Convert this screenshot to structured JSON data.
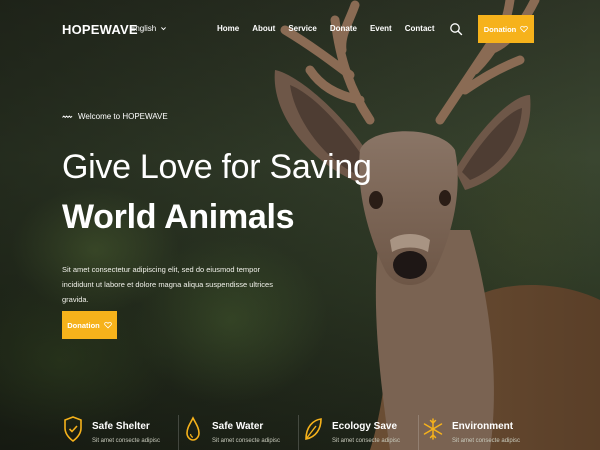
{
  "brand": {
    "name": "HOPEWAVE",
    "accent": "#f6b21b"
  },
  "language": {
    "selected": "English"
  },
  "nav": {
    "items": [
      "Home",
      "About",
      "Service",
      "Donate",
      "Event",
      "Contact"
    ],
    "donation_label": "Donation"
  },
  "hero": {
    "welcome": "Welcome to HOPEWAVE",
    "title_line1": "Give Love for Saving",
    "title_line2": "World Animals",
    "description": "Sit amet consectetur adipiscing elit, sed do eiusmod tempor incididunt ut labore et dolore magna aliqua suspendisse ultrices gravida.",
    "button_label": "Donation"
  },
  "features": [
    {
      "title": "Safe Shelter",
      "icon": "shield-icon",
      "text": "Sit amet consecte adipisc"
    },
    {
      "title": "Safe Water",
      "icon": "water-drop-icon",
      "text": "Sit amet consecte adipisc"
    },
    {
      "title": "Ecology Save",
      "icon": "leaf-icon",
      "text": "Sit amet consecte adipisc"
    },
    {
      "title": "Environment",
      "icon": "snowflake-icon",
      "text": "Sit amet consecte adipisc"
    }
  ]
}
